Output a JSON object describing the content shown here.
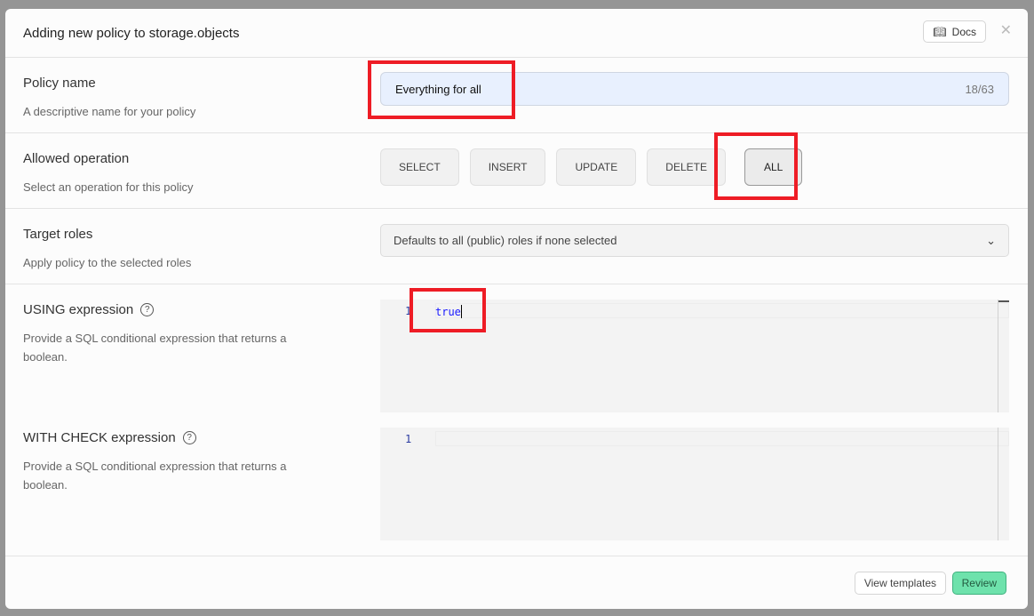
{
  "modal": {
    "title": "Adding new policy to storage.objects",
    "docs_label": "Docs",
    "close_icon": "x-icon"
  },
  "policy_name": {
    "label": "Policy name",
    "description": "A descriptive name for your policy",
    "value": "Everything for all",
    "counter": "18/63"
  },
  "operation": {
    "label": "Allowed operation",
    "description": "Select an operation for this policy",
    "options": [
      "SELECT",
      "INSERT",
      "UPDATE",
      "DELETE",
      "ALL"
    ],
    "selected": "ALL"
  },
  "roles": {
    "label": "Target roles",
    "description": "Apply policy to the selected roles",
    "placeholder": "Defaults to all (public) roles if none selected"
  },
  "using": {
    "label": "USING expression",
    "description": "Provide a SQL conditional expression that returns a boolean.",
    "line_number": "1",
    "code": "true"
  },
  "check": {
    "label": "WITH CHECK expression",
    "description": "Provide a SQL conditional expression that returns a boolean.",
    "line_number": "1",
    "code": ""
  },
  "footer": {
    "view_templates": "View templates",
    "review": "Review"
  },
  "colors": {
    "highlight": "#ee1c25",
    "review": "#6ee2ac",
    "input_bg": "#e8f0fe"
  }
}
